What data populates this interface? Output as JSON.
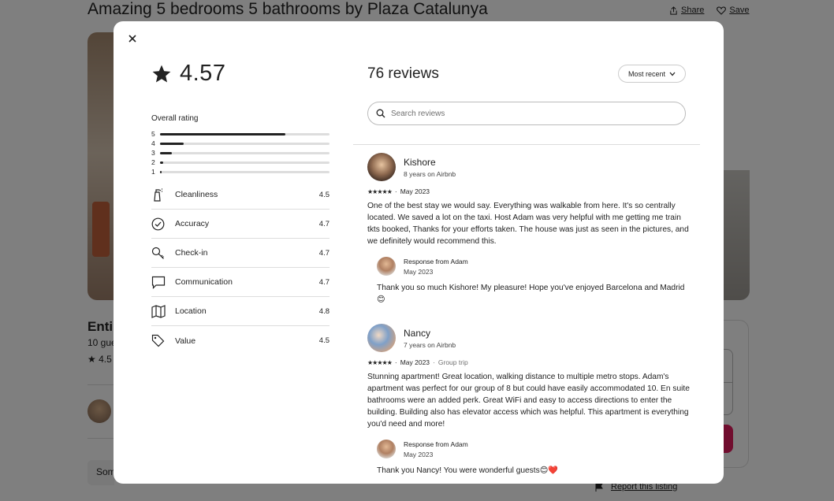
{
  "background": {
    "listing_title": "Amazing 5 bedrooms 5 bathrooms by Plaza Catalunya",
    "share_label": "Share",
    "save_label": "Save",
    "entire_partial": "Entir",
    "guests_partial": "10 gue",
    "rating_partial": "4.5",
    "some_partial": "Som",
    "report_label": "Report this listing"
  },
  "modal": {
    "overall_rating": "4.57",
    "overall_label": "Overall rating",
    "distribution": [
      {
        "stars": "5",
        "fraction": 0.74
      },
      {
        "stars": "4",
        "fraction": 0.14
      },
      {
        "stars": "3",
        "fraction": 0.07
      },
      {
        "stars": "2",
        "fraction": 0.02
      },
      {
        "stars": "1",
        "fraction": 0.01
      }
    ],
    "categories": [
      {
        "label": "Cleanliness",
        "value": "4.5",
        "icon": "spray-bottle-icon"
      },
      {
        "label": "Accuracy",
        "value": "4.7",
        "icon": "check-circle-icon"
      },
      {
        "label": "Check-in",
        "value": "4.7",
        "icon": "key-icon"
      },
      {
        "label": "Communication",
        "value": "4.7",
        "icon": "chat-bubble-icon"
      },
      {
        "label": "Location",
        "value": "4.8",
        "icon": "map-icon"
      },
      {
        "label": "Value",
        "value": "4.5",
        "icon": "tag-icon"
      }
    ],
    "reviews_count": "76 reviews",
    "sort_label": "Most recent",
    "search_placeholder": "Search reviews",
    "reviews": [
      {
        "name": "Kishore",
        "tenure": "8 years on Airbnb",
        "stars": "★★★★★",
        "date": "May 2023",
        "trip": "",
        "text": "One of the best stay we would say. Everything was walkable from here. It's so centrally located. We saved a lot on the taxi. Host Adam was very helpful with me getting me train tkts booked, Thanks for your efforts taken. The house was just as seen in the pictures, and we definitely would recommend this.",
        "response_title": "Response from Adam",
        "response_date": "May 2023",
        "response_text": "Thank you so much Kishore! My pleasure! Hope you've enjoyed Barcelona and Madrid😊"
      },
      {
        "name": "Nancy",
        "tenure": "7 years on Airbnb",
        "stars": "★★★★★",
        "date": "May 2023",
        "trip": "Group trip",
        "text": "Stunning apartment! Great location, walking distance to multiple metro stops. Adam's apartment was perfect for our group of 8 but could have easily accommodated 10. En suite bathrooms were an added perk. Great WiFi and easy to access directions to enter the building. Building also has elevator access which was helpful. This apartment is everything you'd need and more!",
        "response_title": "Response from Adam",
        "response_date": "May 2023",
        "response_text": "Thank you Nancy! You were wonderful guests😊❤️"
      }
    ]
  }
}
